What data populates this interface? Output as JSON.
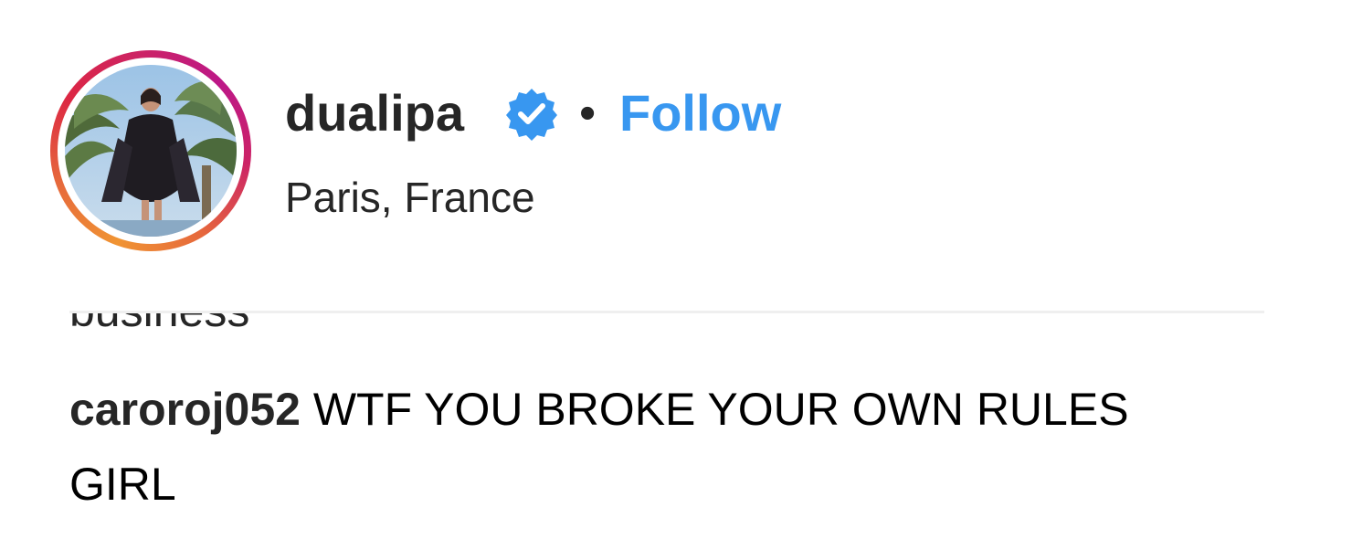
{
  "post_header": {
    "username": "dualipa",
    "verified_icon": "verified-badge-icon",
    "separator": "•",
    "follow_label": "Follow",
    "location": "Paris, France"
  },
  "comments": {
    "partial_previous_text": "business",
    "items": [
      {
        "author": "caroroj052",
        "text": "WTF YOU BROKE YOUR OWN RULES GIRL"
      }
    ]
  },
  "colors": {
    "link_blue": "#3897f0",
    "verified_blue": "#3897f0",
    "text": "#262626",
    "divider": "#efefef"
  }
}
